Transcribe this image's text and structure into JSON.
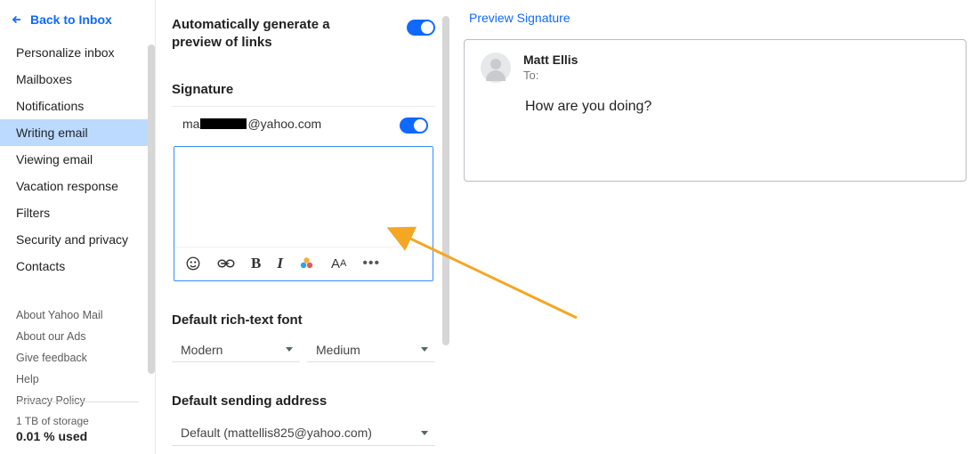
{
  "back_label": "Back to Inbox",
  "sidebar": {
    "items": [
      {
        "label": "Personalize inbox"
      },
      {
        "label": "Mailboxes"
      },
      {
        "label": "Notifications"
      },
      {
        "label": "Writing email",
        "active": true
      },
      {
        "label": "Viewing email"
      },
      {
        "label": "Vacation response"
      },
      {
        "label": "Filters"
      },
      {
        "label": "Security and privacy"
      },
      {
        "label": "Contacts"
      }
    ],
    "meta": [
      {
        "label": "About Yahoo Mail"
      },
      {
        "label": "About our Ads"
      },
      {
        "label": "Give feedback"
      },
      {
        "label": "Help"
      },
      {
        "label": "Privacy Policy"
      }
    ],
    "storage": {
      "line1": "1 TB of storage",
      "line2": "0.01 % used"
    }
  },
  "settings": {
    "preview_links": {
      "title": "Automatically generate a preview of links",
      "enabled": true
    },
    "signature": {
      "title": "Signature",
      "email_prefix": "ma",
      "email_suffix": "@yahoo.com",
      "enabled": true
    },
    "rich_text": {
      "title": "Default rich-text font",
      "font_family": "Modern",
      "font_size": "Medium"
    },
    "default_address": {
      "title": "Default sending address",
      "value": "Default (mattellis825@yahoo.com)"
    }
  },
  "preview": {
    "title": "Preview Signature",
    "from_name": "Matt Ellis",
    "to_label": "To:",
    "body": "How are you doing?"
  }
}
